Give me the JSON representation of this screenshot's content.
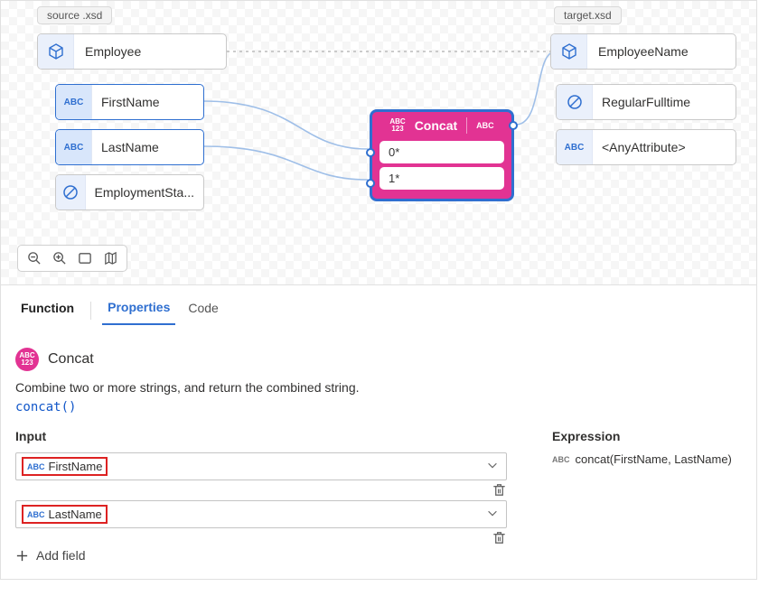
{
  "source_tag": "source .xsd",
  "target_tag": "target.xsd",
  "source": {
    "root": "Employee",
    "fields": [
      "FirstName",
      "LastName",
      "EmploymentSta..."
    ]
  },
  "target": {
    "root": "EmployeeName",
    "fields": [
      "RegularFulltime",
      "<AnyAttribute>"
    ]
  },
  "concat": {
    "title": "Concat",
    "slots": [
      "0*",
      "1*"
    ]
  },
  "toolbar": {
    "zoom_out": "zoom-out",
    "zoom_in": "zoom-in",
    "fit": "fit-screen",
    "map": "minimap"
  },
  "tabs": {
    "function": "Function",
    "properties": "Properties",
    "code": "Code"
  },
  "fn": {
    "name": "Concat",
    "description": "Combine two or more strings, and return the combined string.",
    "signature": "concat()"
  },
  "input": {
    "heading": "Input",
    "fields": [
      "FirstName",
      "LastName"
    ],
    "add_label": "Add field"
  },
  "expression": {
    "heading": "Expression",
    "value": "concat(FirstName, LastName)"
  },
  "icons": {
    "abc_label": "ABC",
    "abc123_a": "ABC",
    "abc123_b": "123"
  },
  "colors": {
    "accent": "#2f6fd0",
    "pink": "#e23393"
  }
}
